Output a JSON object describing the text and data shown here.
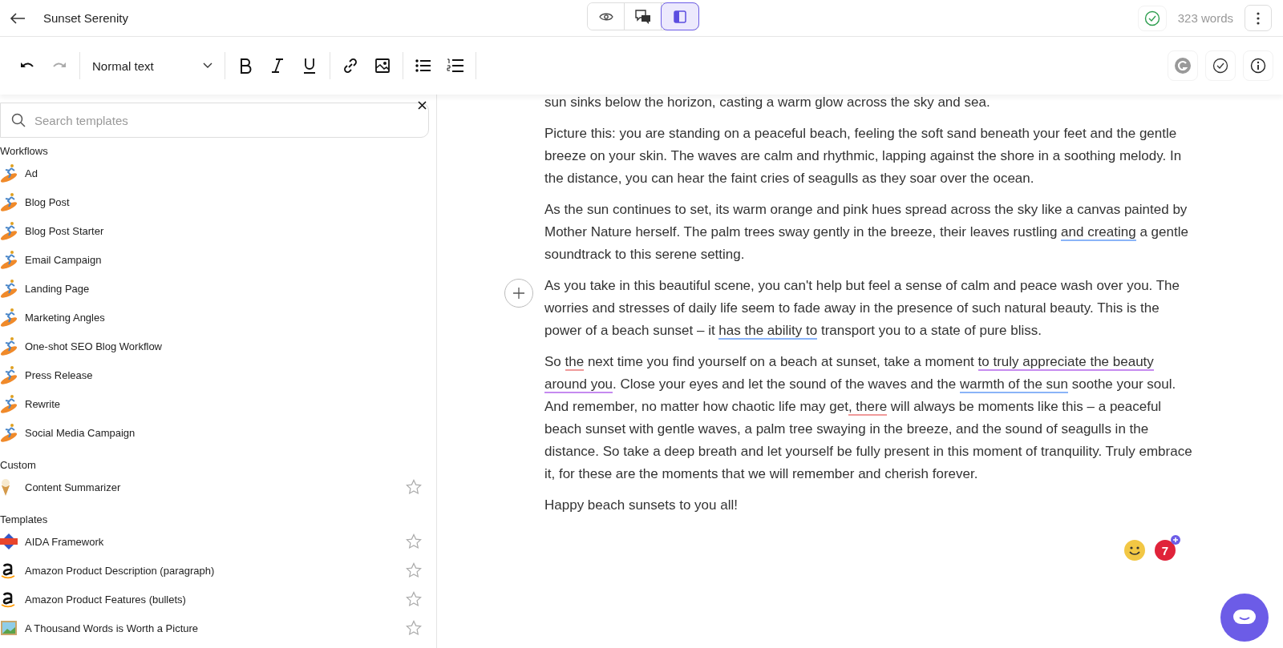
{
  "header": {
    "title": "Sunset Serenity",
    "view_modes": [
      {
        "selected": false
      },
      {
        "selected": false
      },
      {
        "selected": true
      }
    ],
    "word_count": "323 words"
  },
  "toolbar": {
    "style_select": "Normal text"
  },
  "sidebar": {
    "search": {
      "placeholder": "Search templates"
    },
    "sections": [
      {
        "title": "Workflows",
        "items": [
          {
            "label": "Ad"
          },
          {
            "label": "Blog Post"
          },
          {
            "label": "Blog Post Starter"
          },
          {
            "label": "Email Campaign"
          },
          {
            "label": "Landing Page"
          },
          {
            "label": "Marketing Angles"
          },
          {
            "label": "One-shot SEO Blog Workflow"
          },
          {
            "label": "Press Release"
          },
          {
            "label": "Rewrite"
          },
          {
            "label": "Social Media Campaign"
          }
        ]
      },
      {
        "title": "Custom",
        "items": [
          {
            "label": "Content Summarizer",
            "starred": false
          }
        ]
      },
      {
        "title": "Templates",
        "items": [
          {
            "label": "AIDA Framework",
            "starred": false
          },
          {
            "label": "Amazon Product Description (paragraph)",
            "starred": false
          },
          {
            "label": "Amazon Product Features (bullets)",
            "starred": false
          },
          {
            "label": "A Thousand Words is Worth a Picture",
            "starred": false
          }
        ]
      }
    ]
  },
  "document": {
    "paragraphs": [
      [
        {
          "text": "sun sinks below the horizon, casting a warm glow across the sky and sea."
        }
      ],
      [
        {
          "text": "Picture this: you are standing on a peaceful beach, feeling the soft sand beneath your feet and the gentle breeze on your skin. The waves are calm and rhythmic, lapping against the shore in a soothing melody. In the distance, you can hear the faint cries of seagulls as they soar over the ocean."
        }
      ],
      [
        {
          "text": "As the sun continues to set, its warm orange and pink hues spread across the sky like a canvas painted by Mother Nature herself. The palm trees sway gently in the breeze, their leaves rustling "
        },
        {
          "text": "and creating",
          "color": "#8ab4f8"
        },
        {
          "text": " a gentle soundtrack to this serene setting."
        }
      ],
      [
        {
          "text": "As you take in this beautiful scene, you can't help but feel a sense of calm and peace wash over you. The worries and stresses of daily life seem to fade away in the presence of such natural beauty. This is the power of a beach sunset – it "
        },
        {
          "text": "has the ability to",
          "color": "#8ab4f8"
        },
        {
          "text": " transport you to a state of pure bliss."
        }
      ],
      [
        {
          "text": "So "
        },
        {
          "text": "the",
          "color": "#f09a9a"
        },
        {
          "text": " next time you find yourself on a beach at sunset, take a moment "
        },
        {
          "text": "to truly appreciate the beauty around you",
          "color": "#c58af0"
        },
        {
          "text": ". Close your eyes and let the sound of the waves and the "
        },
        {
          "text": "warmth of the sun",
          "color": "#8ab4f8"
        },
        {
          "text": " soothe your soul. And remember, no matter how chaotic life may get"
        },
        {
          "text": ", there",
          "color": "#f09a9a"
        },
        {
          "text": " will always be moments like this – a peaceful beach sunset with gentle waves, a palm tree swaying in the breeze, and the sound of seagulls in the distance.  So take a deep breath and let yourself be fully present in this moment of tranquility.  Truly embrace it, for these are the moments that we will remember and cherish forever."
        }
      ],
      [
        {
          "text": "Happy beach sunsets to you all!"
        }
      ]
    ],
    "suggestion_count": "7"
  }
}
